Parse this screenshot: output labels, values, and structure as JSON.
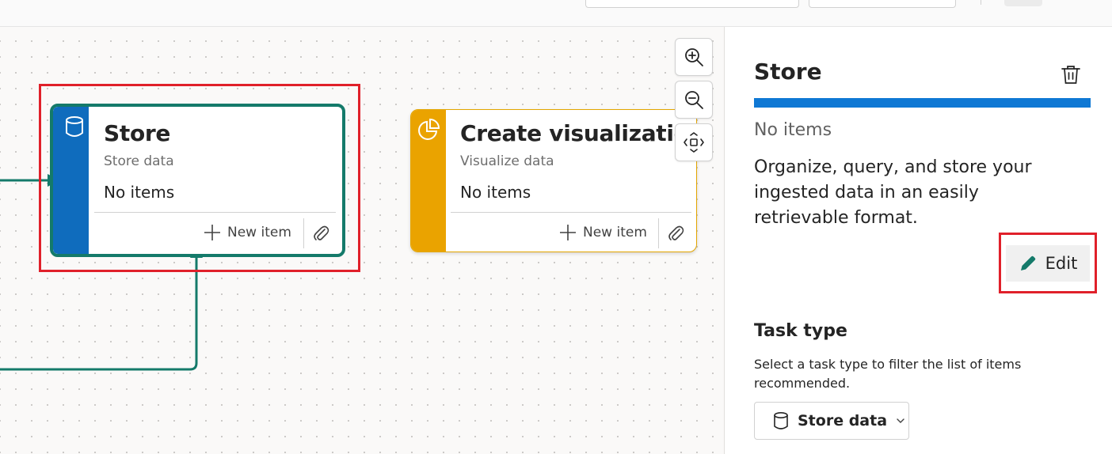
{
  "colors": {
    "store_accent": "#0f6cbd",
    "store_border": "#147a6a",
    "viz_accent": "#eaa300",
    "highlight": "#e0202a",
    "panel_bar": "#0f78d4"
  },
  "canvas": {
    "cards": [
      {
        "icon": "database-icon",
        "title": "Store",
        "subtitle": "Store data",
        "count": "No items",
        "new_item_label": "New item"
      },
      {
        "icon": "pie-chart-icon",
        "title": "Create visualizations",
        "subtitle": "Visualize data",
        "count": "No items",
        "new_item_label": "New item"
      }
    ],
    "zoom_controls": [
      "zoom-in-icon",
      "zoom-out-icon",
      "fit-to-view-icon"
    ]
  },
  "panel": {
    "title": "Store",
    "count": "No items",
    "description": "Organize, query, and store your ingested data in an easily retrievable format.",
    "edit_label": "Edit",
    "task_type": {
      "heading": "Task type",
      "description": "Select a task type to filter the list of items recommended.",
      "selected": "Store data"
    }
  }
}
